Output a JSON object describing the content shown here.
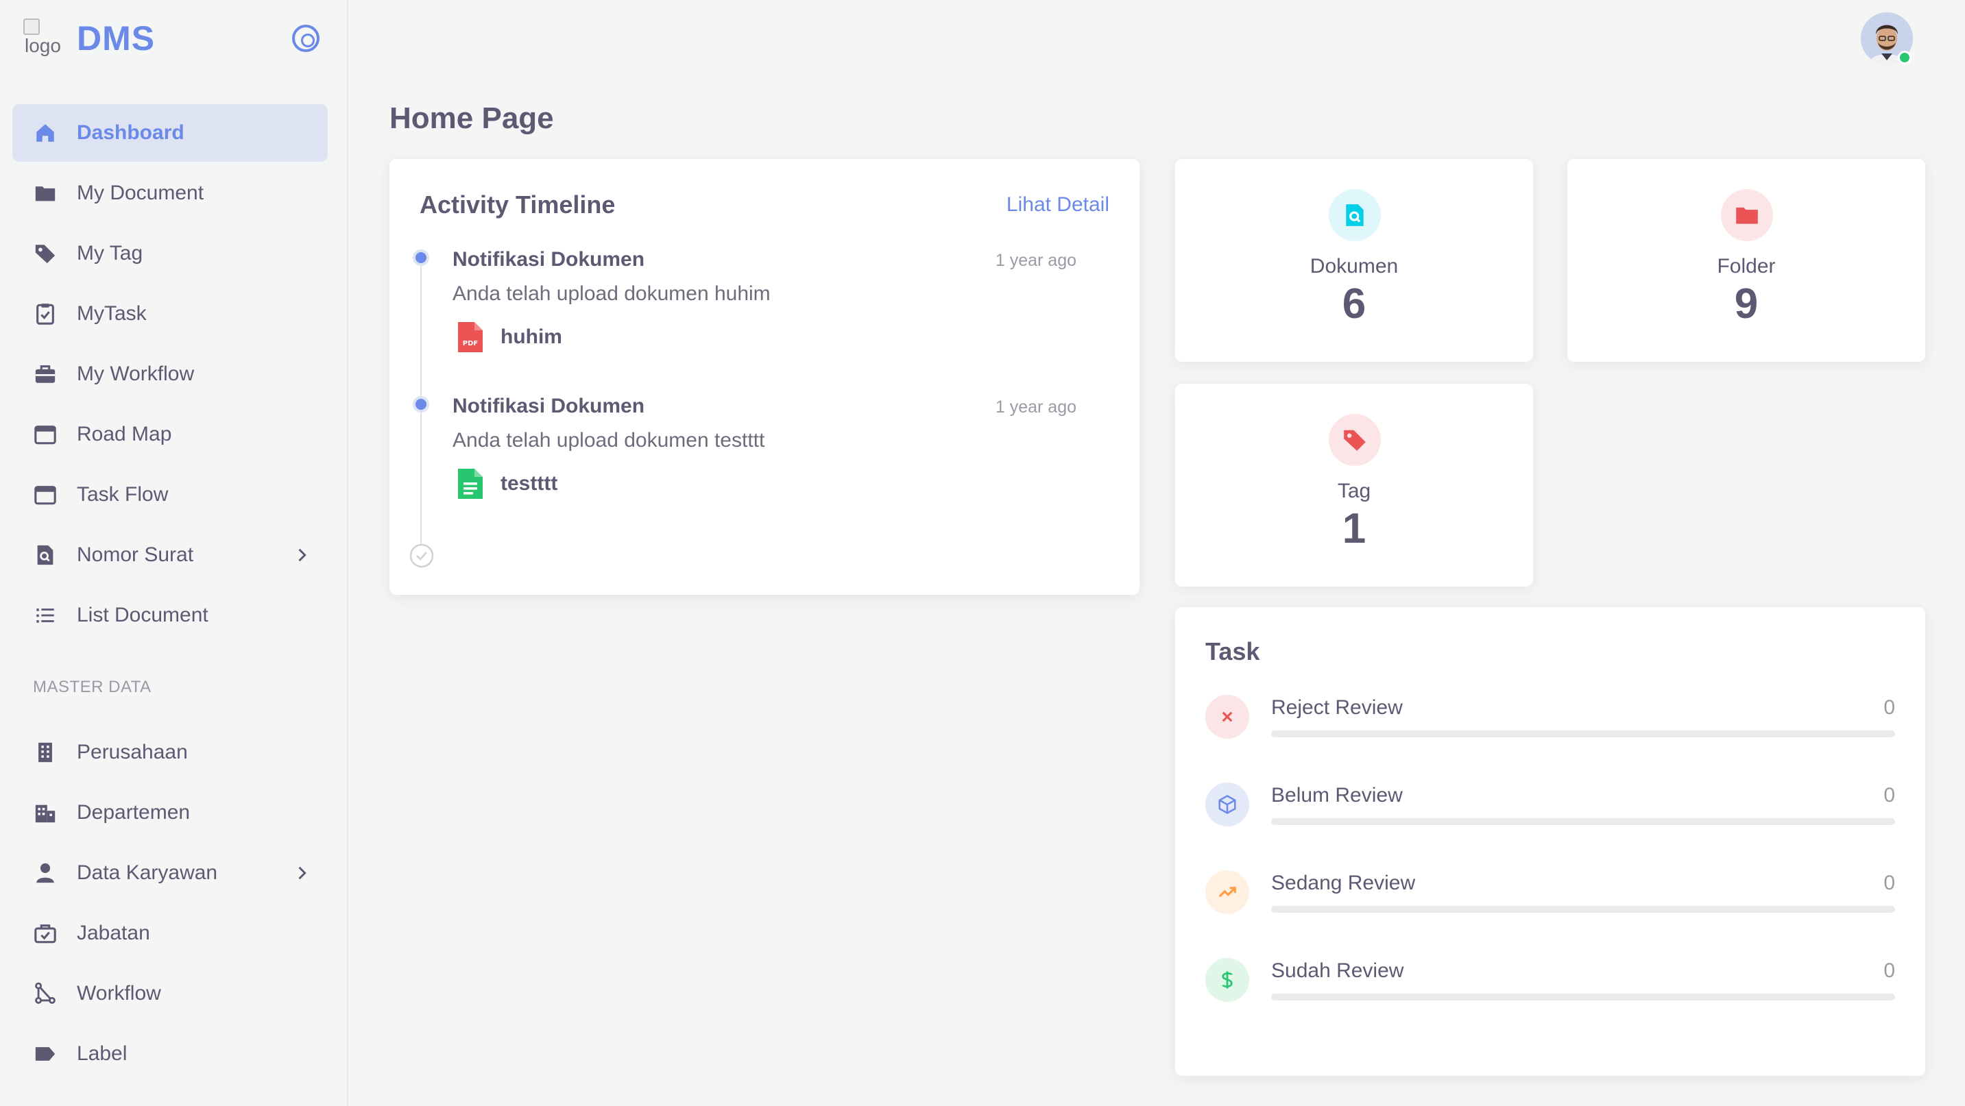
{
  "sidebar": {
    "logo_alt": "logo",
    "brand": "DMS",
    "items": [
      {
        "label": "Dashboard",
        "icon": "home-icon",
        "active": true
      },
      {
        "label": "My Document",
        "icon": "folder-icon"
      },
      {
        "label": "My Tag",
        "icon": "tag-icon"
      },
      {
        "label": "MyTask",
        "icon": "clipboard-check-icon"
      },
      {
        "label": "My Workflow",
        "icon": "briefcase-icon"
      },
      {
        "label": "Road Map",
        "icon": "window-icon"
      },
      {
        "label": "Task Flow",
        "icon": "window-icon"
      },
      {
        "label": "Nomor Surat",
        "icon": "file-search-icon",
        "has_children": true
      },
      {
        "label": "List Document",
        "icon": "list-icon"
      }
    ],
    "master_header": "MASTER DATA",
    "master_items": [
      {
        "label": "Perusahaan",
        "icon": "building-icon"
      },
      {
        "label": "Departemen",
        "icon": "buildings-icon"
      },
      {
        "label": "Data Karyawan",
        "icon": "user-icon",
        "has_children": true
      },
      {
        "label": "Jabatan",
        "icon": "briefcase-check-icon"
      },
      {
        "label": "Workflow",
        "icon": "workflow-icon"
      },
      {
        "label": "Label",
        "icon": "label-icon"
      }
    ]
  },
  "header": {
    "page_title": "Home Page"
  },
  "timeline": {
    "title": "Activity Timeline",
    "link": "Lihat Detail",
    "items": [
      {
        "heading": "Notifikasi Dokumen",
        "time": "1 year ago",
        "desc": "Anda telah upload dokumen huhim",
        "file": "huhim",
        "file_icon": "pdf-file-icon"
      },
      {
        "heading": "Notifikasi Dokumen",
        "time": "1 year ago",
        "desc": "Anda telah upload dokumen testttt",
        "file": "testttt",
        "file_icon": "document-file-icon"
      }
    ]
  },
  "stats": [
    {
      "label": "Dokumen",
      "value": "6",
      "icon": "document-search-icon",
      "color": "#00cfe8"
    },
    {
      "label": "Folder",
      "value": "9",
      "icon": "folder-icon",
      "color": "#ea5455"
    },
    {
      "label": "Tag",
      "value": "1",
      "icon": "tag-icon",
      "color": "#ea5455"
    }
  ],
  "task": {
    "title": "Task",
    "rows": [
      {
        "label": "Reject Review",
        "value": "0",
        "progress": 0,
        "icon": "x-icon",
        "color": "#ea5455"
      },
      {
        "label": "Belum Review",
        "value": "0",
        "progress": 0,
        "icon": "box-icon",
        "color": "#6a89e8"
      },
      {
        "label": "Sedang Review",
        "value": "0",
        "progress": 0,
        "icon": "trending-up-icon",
        "color": "#ff9f43"
      },
      {
        "label": "Sudah Review",
        "value": "0",
        "progress": 0,
        "icon": "dollar-icon",
        "color": "#28c76f"
      }
    ]
  }
}
